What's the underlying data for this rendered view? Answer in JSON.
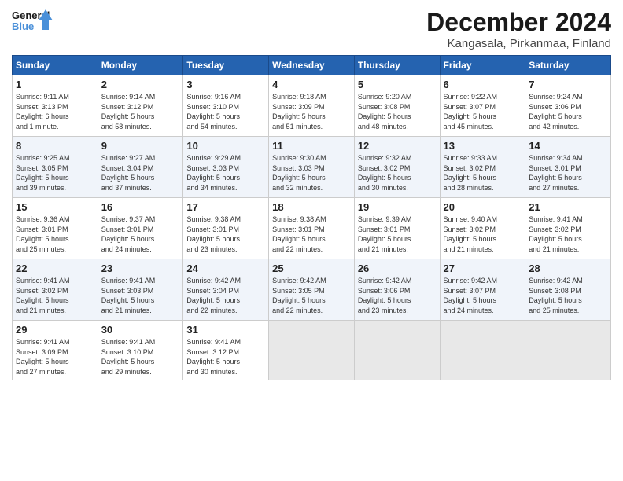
{
  "header": {
    "logo_line1": "General",
    "logo_line2": "Blue",
    "month_title": "December 2024",
    "subtitle": "Kangasala, Pirkanmaa, Finland"
  },
  "weekdays": [
    "Sunday",
    "Monday",
    "Tuesday",
    "Wednesday",
    "Thursday",
    "Friday",
    "Saturday"
  ],
  "weeks": [
    [
      {
        "day": "1",
        "info": "Sunrise: 9:11 AM\nSunset: 3:13 PM\nDaylight: 6 hours\nand 1 minute."
      },
      {
        "day": "2",
        "info": "Sunrise: 9:14 AM\nSunset: 3:12 PM\nDaylight: 5 hours\nand 58 minutes."
      },
      {
        "day": "3",
        "info": "Sunrise: 9:16 AM\nSunset: 3:10 PM\nDaylight: 5 hours\nand 54 minutes."
      },
      {
        "day": "4",
        "info": "Sunrise: 9:18 AM\nSunset: 3:09 PM\nDaylight: 5 hours\nand 51 minutes."
      },
      {
        "day": "5",
        "info": "Sunrise: 9:20 AM\nSunset: 3:08 PM\nDaylight: 5 hours\nand 48 minutes."
      },
      {
        "day": "6",
        "info": "Sunrise: 9:22 AM\nSunset: 3:07 PM\nDaylight: 5 hours\nand 45 minutes."
      },
      {
        "day": "7",
        "info": "Sunrise: 9:24 AM\nSunset: 3:06 PM\nDaylight: 5 hours\nand 42 minutes."
      }
    ],
    [
      {
        "day": "8",
        "info": "Sunrise: 9:25 AM\nSunset: 3:05 PM\nDaylight: 5 hours\nand 39 minutes."
      },
      {
        "day": "9",
        "info": "Sunrise: 9:27 AM\nSunset: 3:04 PM\nDaylight: 5 hours\nand 37 minutes."
      },
      {
        "day": "10",
        "info": "Sunrise: 9:29 AM\nSunset: 3:03 PM\nDaylight: 5 hours\nand 34 minutes."
      },
      {
        "day": "11",
        "info": "Sunrise: 9:30 AM\nSunset: 3:03 PM\nDaylight: 5 hours\nand 32 minutes."
      },
      {
        "day": "12",
        "info": "Sunrise: 9:32 AM\nSunset: 3:02 PM\nDaylight: 5 hours\nand 30 minutes."
      },
      {
        "day": "13",
        "info": "Sunrise: 9:33 AM\nSunset: 3:02 PM\nDaylight: 5 hours\nand 28 minutes."
      },
      {
        "day": "14",
        "info": "Sunrise: 9:34 AM\nSunset: 3:01 PM\nDaylight: 5 hours\nand 27 minutes."
      }
    ],
    [
      {
        "day": "15",
        "info": "Sunrise: 9:36 AM\nSunset: 3:01 PM\nDaylight: 5 hours\nand 25 minutes."
      },
      {
        "day": "16",
        "info": "Sunrise: 9:37 AM\nSunset: 3:01 PM\nDaylight: 5 hours\nand 24 minutes."
      },
      {
        "day": "17",
        "info": "Sunrise: 9:38 AM\nSunset: 3:01 PM\nDaylight: 5 hours\nand 23 minutes."
      },
      {
        "day": "18",
        "info": "Sunrise: 9:38 AM\nSunset: 3:01 PM\nDaylight: 5 hours\nand 22 minutes."
      },
      {
        "day": "19",
        "info": "Sunrise: 9:39 AM\nSunset: 3:01 PM\nDaylight: 5 hours\nand 21 minutes."
      },
      {
        "day": "20",
        "info": "Sunrise: 9:40 AM\nSunset: 3:02 PM\nDaylight: 5 hours\nand 21 minutes."
      },
      {
        "day": "21",
        "info": "Sunrise: 9:41 AM\nSunset: 3:02 PM\nDaylight: 5 hours\nand 21 minutes."
      }
    ],
    [
      {
        "day": "22",
        "info": "Sunrise: 9:41 AM\nSunset: 3:02 PM\nDaylight: 5 hours\nand 21 minutes."
      },
      {
        "day": "23",
        "info": "Sunrise: 9:41 AM\nSunset: 3:03 PM\nDaylight: 5 hours\nand 21 minutes."
      },
      {
        "day": "24",
        "info": "Sunrise: 9:42 AM\nSunset: 3:04 PM\nDaylight: 5 hours\nand 22 minutes."
      },
      {
        "day": "25",
        "info": "Sunrise: 9:42 AM\nSunset: 3:05 PM\nDaylight: 5 hours\nand 22 minutes."
      },
      {
        "day": "26",
        "info": "Sunrise: 9:42 AM\nSunset: 3:06 PM\nDaylight: 5 hours\nand 23 minutes."
      },
      {
        "day": "27",
        "info": "Sunrise: 9:42 AM\nSunset: 3:07 PM\nDaylight: 5 hours\nand 24 minutes."
      },
      {
        "day": "28",
        "info": "Sunrise: 9:42 AM\nSunset: 3:08 PM\nDaylight: 5 hours\nand 25 minutes."
      }
    ],
    [
      {
        "day": "29",
        "info": "Sunrise: 9:41 AM\nSunset: 3:09 PM\nDaylight: 5 hours\nand 27 minutes."
      },
      {
        "day": "30",
        "info": "Sunrise: 9:41 AM\nSunset: 3:10 PM\nDaylight: 5 hours\nand 29 minutes."
      },
      {
        "day": "31",
        "info": "Sunrise: 9:41 AM\nSunset: 3:12 PM\nDaylight: 5 hours\nand 30 minutes."
      },
      null,
      null,
      null,
      null
    ]
  ]
}
